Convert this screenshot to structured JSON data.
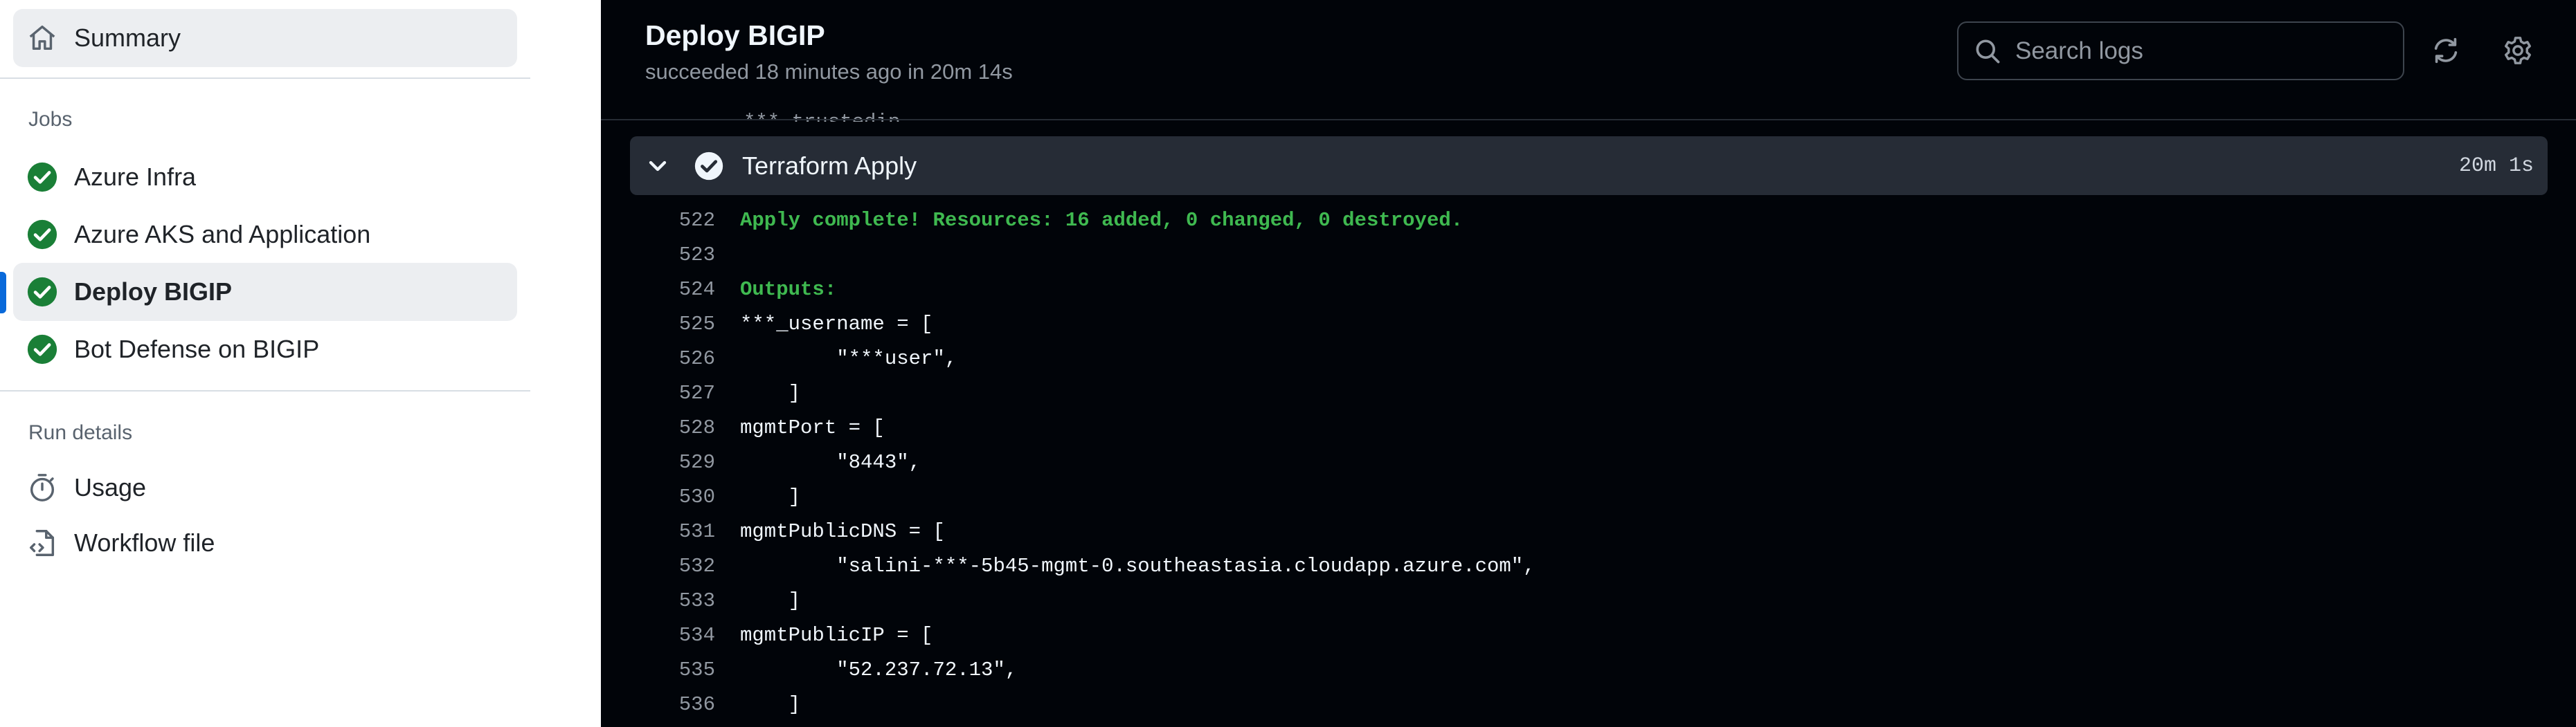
{
  "sidebar": {
    "summary_label": "Summary",
    "jobs_heading": "Jobs",
    "jobs": [
      {
        "label": "Azure Infra",
        "status": "success"
      },
      {
        "label": "Azure AKS and Application",
        "status": "success"
      },
      {
        "label": "Deploy BIGIP",
        "status": "success"
      },
      {
        "label": "Bot Defense on BIGIP",
        "status": "success"
      }
    ],
    "run_details_heading": "Run details",
    "usage_label": "Usage",
    "workflow_file_label": "Workflow file"
  },
  "header": {
    "title": "Deploy BIGIP",
    "subtitle": "succeeded 18 minutes ago in 20m 14s",
    "search_placeholder": "Search logs"
  },
  "step": {
    "title": "Terraform Apply",
    "duration": "20m 1s",
    "stub_text": "  ***_trustedip"
  },
  "log": [
    {
      "n": "522",
      "text": "Apply complete! Resources: 16 added, 0 changed, 0 destroyed.",
      "style": "green"
    },
    {
      "n": "523",
      "text": "",
      "style": ""
    },
    {
      "n": "524",
      "text": "Outputs:",
      "style": "green"
    },
    {
      "n": "525",
      "text": "***_username = [",
      "style": ""
    },
    {
      "n": "526",
      "text": "        \"***user\",",
      "style": ""
    },
    {
      "n": "527",
      "text": "    ]",
      "style": ""
    },
    {
      "n": "528",
      "text": "mgmtPort = [",
      "style": ""
    },
    {
      "n": "529",
      "text": "        \"8443\",",
      "style": ""
    },
    {
      "n": "530",
      "text": "    ]",
      "style": ""
    },
    {
      "n": "531",
      "text": "mgmtPublicDNS = [",
      "style": ""
    },
    {
      "n": "532",
      "text": "        \"salini-***-5b45-mgmt-0.southeastasia.cloudapp.azure.com\",",
      "style": ""
    },
    {
      "n": "533",
      "text": "    ]",
      "style": ""
    },
    {
      "n": "534",
      "text": "mgmtPublicIP = [",
      "style": ""
    },
    {
      "n": "535",
      "text": "        \"52.237.72.13\",",
      "style": ""
    },
    {
      "n": "536",
      "text": "    ]",
      "style": ""
    }
  ],
  "colors": {
    "success": "#1a7f37",
    "accent": "#0969da",
    "log_bg": "#010409",
    "step_header_bg": "#262c36",
    "log_green": "#3fb950"
  }
}
